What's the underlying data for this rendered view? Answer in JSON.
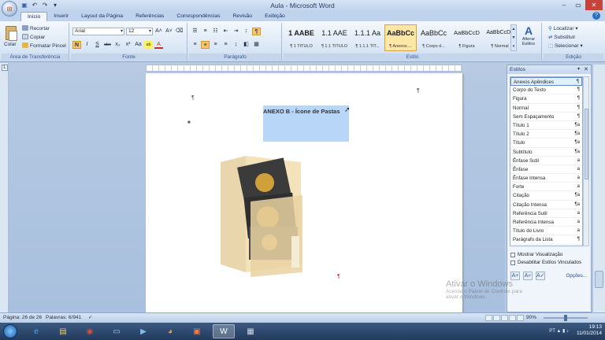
{
  "window": {
    "title": "Aula - Microsoft Word",
    "minimize": "–",
    "maximize": "▭",
    "close": "✕"
  },
  "qat": [
    "W",
    "💾",
    "↶",
    "↷",
    "▾"
  ],
  "tabs": [
    "Início",
    "Inserir",
    "Layout da Página",
    "Referências",
    "Correspondências",
    "Revisão",
    "Exibição"
  ],
  "clipboard": {
    "paste": "Colar",
    "cut": "Recortar",
    "copy": "Copiar",
    "format_painter": "Formatar Pincel",
    "label": "Área de Transferência"
  },
  "font": {
    "name": "Arial",
    "size": "12",
    "label": "Fonte",
    "buttons": [
      "N",
      "I",
      "S",
      "abc",
      "x₂",
      "x²",
      "Aa",
      "ab",
      "A"
    ]
  },
  "paragraph": {
    "label": "Parágrafo"
  },
  "styles_gallery": {
    "label": "Estilo",
    "items": [
      {
        "preview": "1 AABE",
        "name": "¶ 1 TÍTULO"
      },
      {
        "preview": "1.1 AAE",
        "name": "¶ 1.1 TÍTULO"
      },
      {
        "preview": "1.1.1 Aa",
        "name": "¶ 1.1.1 TÍT..."
      },
      {
        "preview": "AaBbCc",
        "name": "¶ Anexos ..."
      },
      {
        "preview": "AaBbCc",
        "name": "¶ Corpo d..."
      },
      {
        "preview": "AaBbCcD",
        "name": "¶ Figura"
      },
      {
        "preview": "AaBbCcDc",
        "name": "¶ Normal"
      }
    ],
    "change_styles": "Alterar Estilos"
  },
  "editing": {
    "label": "Edição",
    "find": "Localizar",
    "replace": "Substituir",
    "select": "Selecionar"
  },
  "document": {
    "heading": "ANEXO B - Ícone de Pastas",
    "pilcrow": "¶"
  },
  "styles_pane": {
    "title": "Estilos",
    "items": [
      {
        "name": "Anexos Apêndices",
        "mark": "¶"
      },
      {
        "name": "Corpo do Texto",
        "mark": "¶"
      },
      {
        "name": "Figura",
        "mark": "¶"
      },
      {
        "name": "Normal",
        "mark": "¶"
      },
      {
        "name": "Sem Espaçamento",
        "mark": "¶"
      },
      {
        "name": "Título 1",
        "mark": "¶a"
      },
      {
        "name": "Título 2",
        "mark": "¶a"
      },
      {
        "name": "Título",
        "mark": "¶a"
      },
      {
        "name": "Subtítulo",
        "mark": "¶a"
      },
      {
        "name": "Ênfase Sutil",
        "mark": "a"
      },
      {
        "name": "Ênfase",
        "mark": "a"
      },
      {
        "name": "Ênfase Intensa",
        "mark": "a"
      },
      {
        "name": "Forte",
        "mark": "a"
      },
      {
        "name": "Citação",
        "mark": "¶a"
      },
      {
        "name": "Citação Intensa",
        "mark": "¶a"
      },
      {
        "name": "Referência Sutil",
        "mark": "a"
      },
      {
        "name": "Referência Intensa",
        "mark": "a"
      },
      {
        "name": "Título do Livro",
        "mark": "a"
      },
      {
        "name": "Parágrafo da Lista",
        "mark": "¶"
      }
    ],
    "show_preview": "Mostrar Visualização",
    "disable_linked": "Desabilitar Estilos Vinculados",
    "options": "Opções..."
  },
  "status": {
    "page": "Página: 26 de 26",
    "words": "Palavras: 6/941",
    "zoom": "90%"
  },
  "watermark": {
    "line1": "Ativar o Windows",
    "line2": "Acesse o Painel de Controle para",
    "line3": "ativar o Windows."
  },
  "tray": {
    "time": "19:13",
    "date": "11/01/2014",
    "lang": "PT"
  }
}
